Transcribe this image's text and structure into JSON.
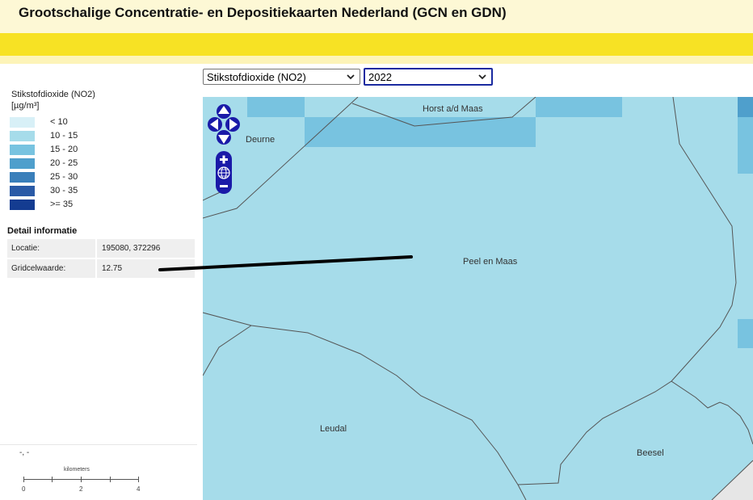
{
  "app": {
    "title": "Grootschalige Concentratie- en Depositiekaarten Nederland (GCN en GDN)"
  },
  "selectors": {
    "component": "Stikstofdioxide (NO2)",
    "year": "2022"
  },
  "legend": {
    "title_line1": "Stikstofdioxide (NO2)",
    "title_line2": "[µg/m³]",
    "items": [
      {
        "label": "< 10",
        "color": "#d8f0f7"
      },
      {
        "label": "10 - 15",
        "color": "#a6dcea"
      },
      {
        "label": "15 - 20",
        "color": "#78c3e0"
      },
      {
        "label": "20 - 25",
        "color": "#4f9fcc"
      },
      {
        "label": "25 - 30",
        "color": "#3a7fba"
      },
      {
        "label": "30 - 35",
        "color": "#2a5aa6"
      },
      {
        "label": ">= 35",
        "color": "#143c91"
      }
    ]
  },
  "detail": {
    "title": "Detail informatie",
    "rows": [
      {
        "key": "Locatie:",
        "value": "195080, 372296"
      },
      {
        "key": "Gridcelwaarde:",
        "value": "12.75"
      }
    ]
  },
  "status": {
    "coordinates": "-, -"
  },
  "scalebar": {
    "unit": "kilometers",
    "ticks": [
      "0",
      "2",
      "4"
    ]
  },
  "map": {
    "places": [
      "Horst a/d Maas",
      "Deurne",
      "Peel en Maas",
      "Leudal",
      "Beesel"
    ]
  },
  "colors": {
    "header_bg": "#fdf8d5",
    "header_band": "#f7e224",
    "map_base": "#a6dcea",
    "nav_control": "#1a1aa8"
  }
}
